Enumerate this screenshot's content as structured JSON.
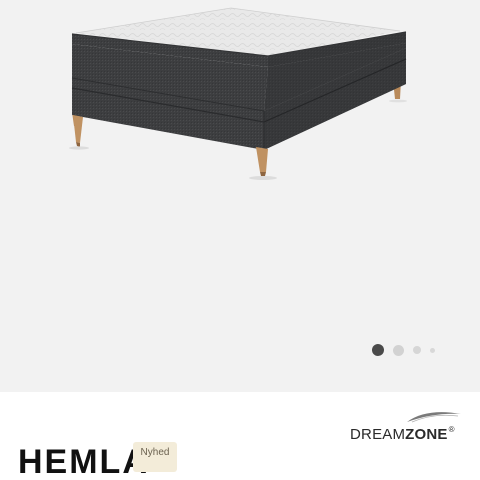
{
  "gallery": {
    "image_alt": "Boxspringseng i mørkegrå stof med topmadras og træben",
    "slide_count": 4,
    "active_slide": 1
  },
  "brand": {
    "name_light": "DREAM",
    "name_bold": "ZONE",
    "registered": "®"
  },
  "product": {
    "name": "HEMLA",
    "badge": "Nyhed"
  },
  "colors": {
    "gallery_background": "#f2f2f2",
    "bed_fabric": "#3d3e40",
    "topper": "#e6e6e6",
    "legs_wood": "#b98a5a",
    "dot_active": "#4a4a4a",
    "dot_inactive": "#d2d2d2",
    "badge_background": "#f3ecd9"
  }
}
